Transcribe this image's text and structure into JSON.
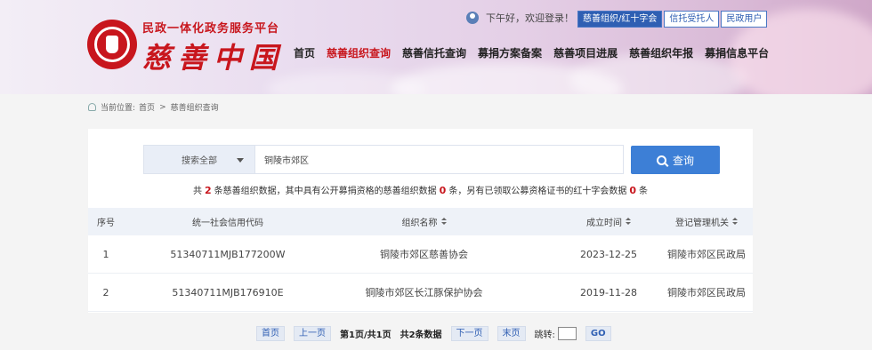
{
  "header": {
    "logo_subtitle": "民政一体化政务服务平台",
    "logo_title": "慈善中国",
    "greeting": "下午好，欢迎登录！",
    "role_tabs": [
      {
        "label": "慈善组织/红十字会",
        "active": true
      },
      {
        "label": "信托受托人",
        "active": false
      },
      {
        "label": "民政用户",
        "active": false
      }
    ],
    "nav": [
      {
        "label": "首页",
        "active": false
      },
      {
        "label": "慈善组织查询",
        "active": true
      },
      {
        "label": "慈善信托查询",
        "active": false
      },
      {
        "label": "募捐方案备案",
        "active": false
      },
      {
        "label": "慈善项目进展",
        "active": false
      },
      {
        "label": "慈善组织年报",
        "active": false
      },
      {
        "label": "募捐信息平台",
        "active": false
      }
    ]
  },
  "breadcrumb": {
    "prefix": "当前位置:",
    "home": "首页",
    "separator": ">",
    "current": "慈善组织查询"
  },
  "search": {
    "scope": "搜索全部",
    "query": "铜陵市郊区",
    "button": "查询"
  },
  "summary": {
    "part1": "共",
    "total": "2",
    "part2": "条慈善组织数据，其中具有公开募捐资格的慈善组织数据",
    "public_count": "0",
    "part3": "条，另有已领取公募资格证书的红十字会数据",
    "redcross_count": "0",
    "part4": "条"
  },
  "table": {
    "headers": {
      "index": "序号",
      "code": "统一社会信用代码",
      "name": "组织名称",
      "date": "成立时间",
      "authority": "登记管理机关"
    },
    "rows": [
      {
        "index": "1",
        "code": "51340711MJB177200W",
        "name": "铜陵市郊区慈善协会",
        "date": "2023-12-25",
        "authority": "铜陵市郊区民政局"
      },
      {
        "index": "2",
        "code": "51340711MJB176910E",
        "name": "铜陵市郊区长江豚保护协会",
        "date": "2019-11-28",
        "authority": "铜陵市郊区民政局"
      }
    ]
  },
  "pager": {
    "first": "首页",
    "prev": "上一页",
    "info": "第1页/共1页",
    "count": "共2条数据",
    "next": "下一页",
    "last": "末页",
    "jump_label": "跳转:",
    "go": "GO"
  },
  "colors": {
    "brand_red": "#c8161d",
    "primary_blue": "#3d7fd6"
  }
}
